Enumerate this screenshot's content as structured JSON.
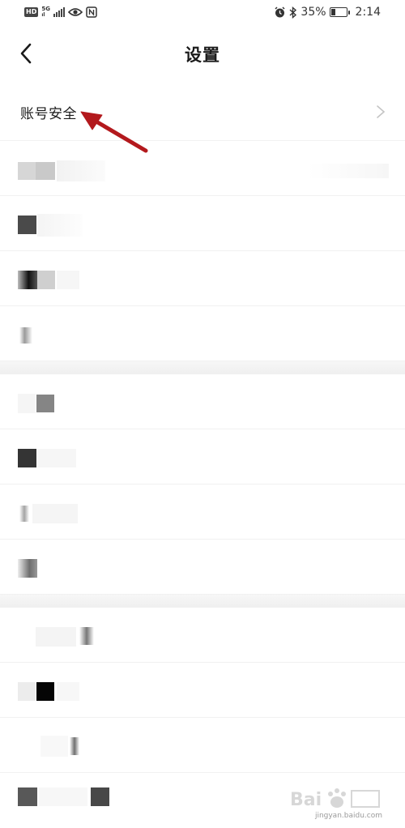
{
  "status_bar": {
    "network_label": "5G",
    "battery_text": "35%",
    "battery_level": 0.35,
    "time": "2:14",
    "icons": [
      "hd-icon",
      "signal-icon",
      "eye-icon",
      "nfc-icon",
      "alarm-icon",
      "bluetooth-icon",
      "battery-icon"
    ]
  },
  "header": {
    "title": "设置",
    "back_icon": "chevron-left-icon"
  },
  "list": {
    "first_item_label": "账号安全",
    "chevron_icon": "chevron-right-icon"
  },
  "annotation": {
    "arrow_color": "#b3191d"
  },
  "watermark": {
    "text": "jingyan.baidu.com"
  }
}
